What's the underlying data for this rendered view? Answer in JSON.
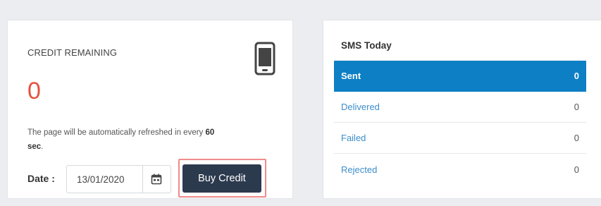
{
  "credit": {
    "title": "CREDIT REMAINING",
    "value": "0",
    "refresh_text": "The page will be automatically refreshed in every ",
    "refresh_seconds": "60",
    "refresh_unit": "sec",
    "refresh_end": ".",
    "date_label": "Date :",
    "date_value": "13/01/2020",
    "buy_label": "Buy Credit",
    "icon": "mobile-phone-icon",
    "accent_color": "#e5533f"
  },
  "sms": {
    "title": "SMS Today",
    "rows": [
      {
        "label": "Sent",
        "value": "0"
      },
      {
        "label": "Delivered",
        "value": "0"
      },
      {
        "label": "Failed",
        "value": "0"
      },
      {
        "label": "Rejected",
        "value": "0"
      }
    ],
    "active_color": "#0d7fc4"
  }
}
